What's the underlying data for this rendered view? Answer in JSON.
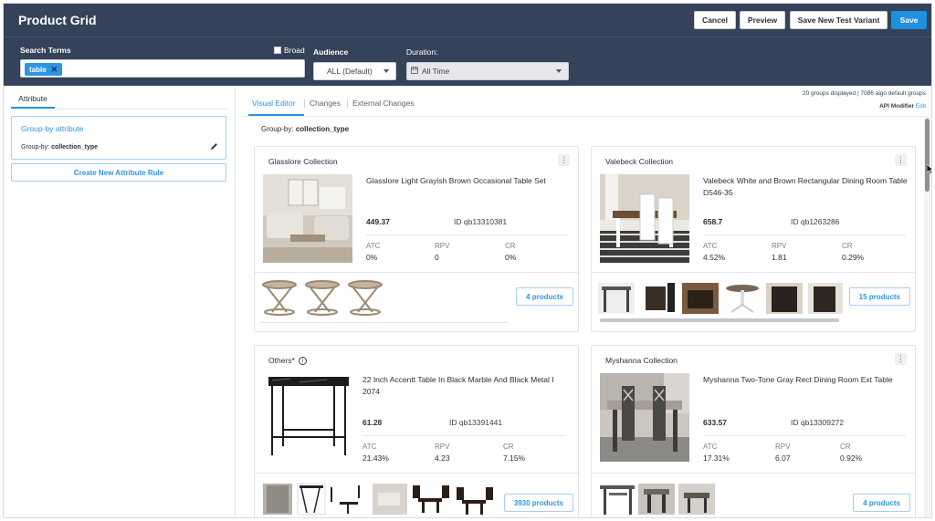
{
  "header": {
    "title": "Product Grid",
    "buttons": {
      "cancel": "Cancel",
      "preview": "Preview",
      "save_variant": "Save New Test Variant",
      "save": "Save"
    }
  },
  "filters": {
    "search_label": "Search Terms",
    "search_chip": "table",
    "broad_label": "Broad",
    "broad_checked": false,
    "audience_label": "Audience",
    "audience_value": "ALL (Default)",
    "duration_label": "Duration:",
    "duration_value": "All Time"
  },
  "sidebar": {
    "tab": "Attribute",
    "group_card": {
      "title": "Group-by attribute",
      "label": "Group-by:",
      "value": "collection_type"
    },
    "create_button": "Create New Attribute Rule"
  },
  "main": {
    "tabs": [
      {
        "label": "Visual Editor",
        "active": true
      },
      {
        "label": "Changes",
        "active": false
      },
      {
        "label": "External Changes",
        "active": false
      }
    ],
    "groups_info": "20 groups displayed | 7086 algo default groups",
    "api_modifier_label": "API Modifier",
    "api_modifier_edit": "Edit",
    "groupby_label": "Group-by:",
    "groupby_value": "collection_type",
    "metric_labels": {
      "atc": "ATC",
      "rpv": "RPV",
      "cr": "CR"
    },
    "cards": [
      {
        "name": "Glasslore Collection",
        "title": "Glasslore Light Grayish Brown Occasional Table Set",
        "price": "449.37",
        "id": "ID  qb13310381",
        "atc": "0%",
        "rpv": "0",
        "cr": "0%",
        "products": "4 products"
      },
      {
        "name": "Valebeck Collection",
        "title": "Valebeck White and Brown Rectangular Dining Room Table D546-35",
        "price": "658.7",
        "id": "ID  qb1263286",
        "atc": "4.52%",
        "rpv": "1.81",
        "cr": "0.29%",
        "products": "15 products"
      },
      {
        "name": "Others*",
        "title": "22 Inch Accentt Table In Black Marble And Black Metal I 2074",
        "price": "61.28",
        "id": "ID  qb13391441",
        "atc": "21.43%",
        "rpv": "4.23",
        "cr": "7.15%",
        "products": "3930 products"
      },
      {
        "name": "Myshanna Collection",
        "title": "Myshanna Two-Tone Gray Rect Dining Room Ext Table",
        "price": "633.57",
        "id": "ID  qb13309272",
        "atc": "17.31%",
        "rpv": "6.07",
        "cr": "0.92%",
        "products": "4 products"
      }
    ]
  },
  "colors": {
    "header_bg": "#34435a",
    "accent": "#2f95e3",
    "save": "#1f8fe0"
  }
}
